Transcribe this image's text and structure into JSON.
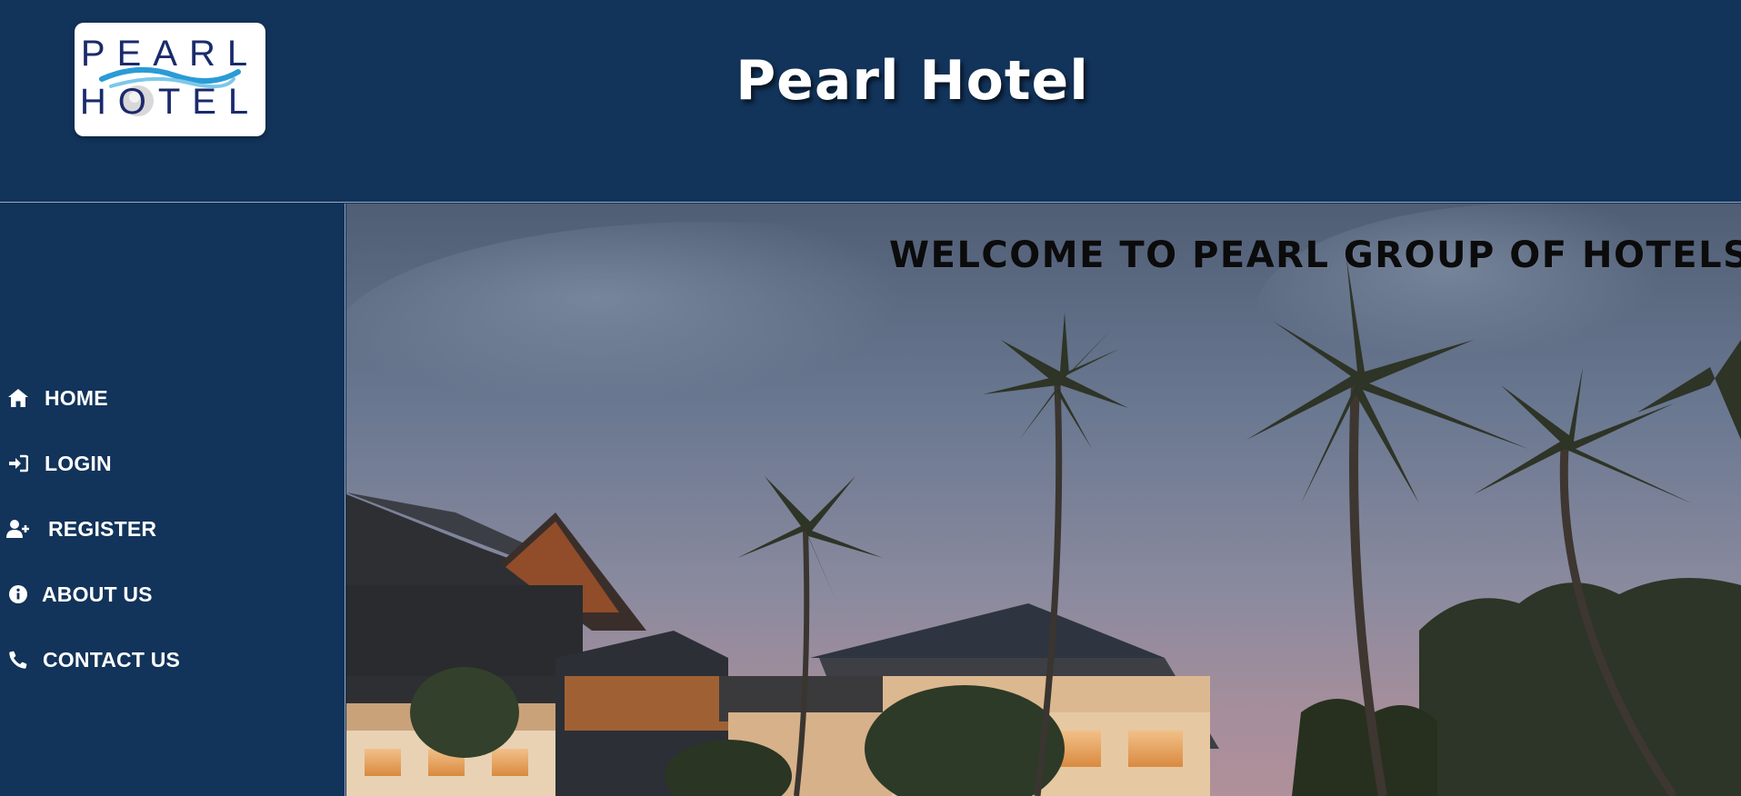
{
  "header": {
    "title": "Pearl Hotel",
    "logo": {
      "line1": "PEARL",
      "line2": "HOTEL"
    }
  },
  "sidebar": {
    "items": [
      {
        "label": "HOME",
        "icon": "home-icon"
      },
      {
        "label": "LOGIN",
        "icon": "login-icon"
      },
      {
        "label": "REGISTER",
        "icon": "user-plus-icon"
      },
      {
        "label": "ABOUT US",
        "icon": "info-icon"
      },
      {
        "label": "CONTACT US",
        "icon": "phone-icon"
      }
    ]
  },
  "hero": {
    "welcome_text": "WELCOME TO PEARL GROUP OF HOTELS"
  },
  "colors": {
    "navy": "#12335a",
    "white": "#ffffff",
    "logo_text": "#1a2a6c",
    "logo_wave": "#2a9bd6"
  }
}
